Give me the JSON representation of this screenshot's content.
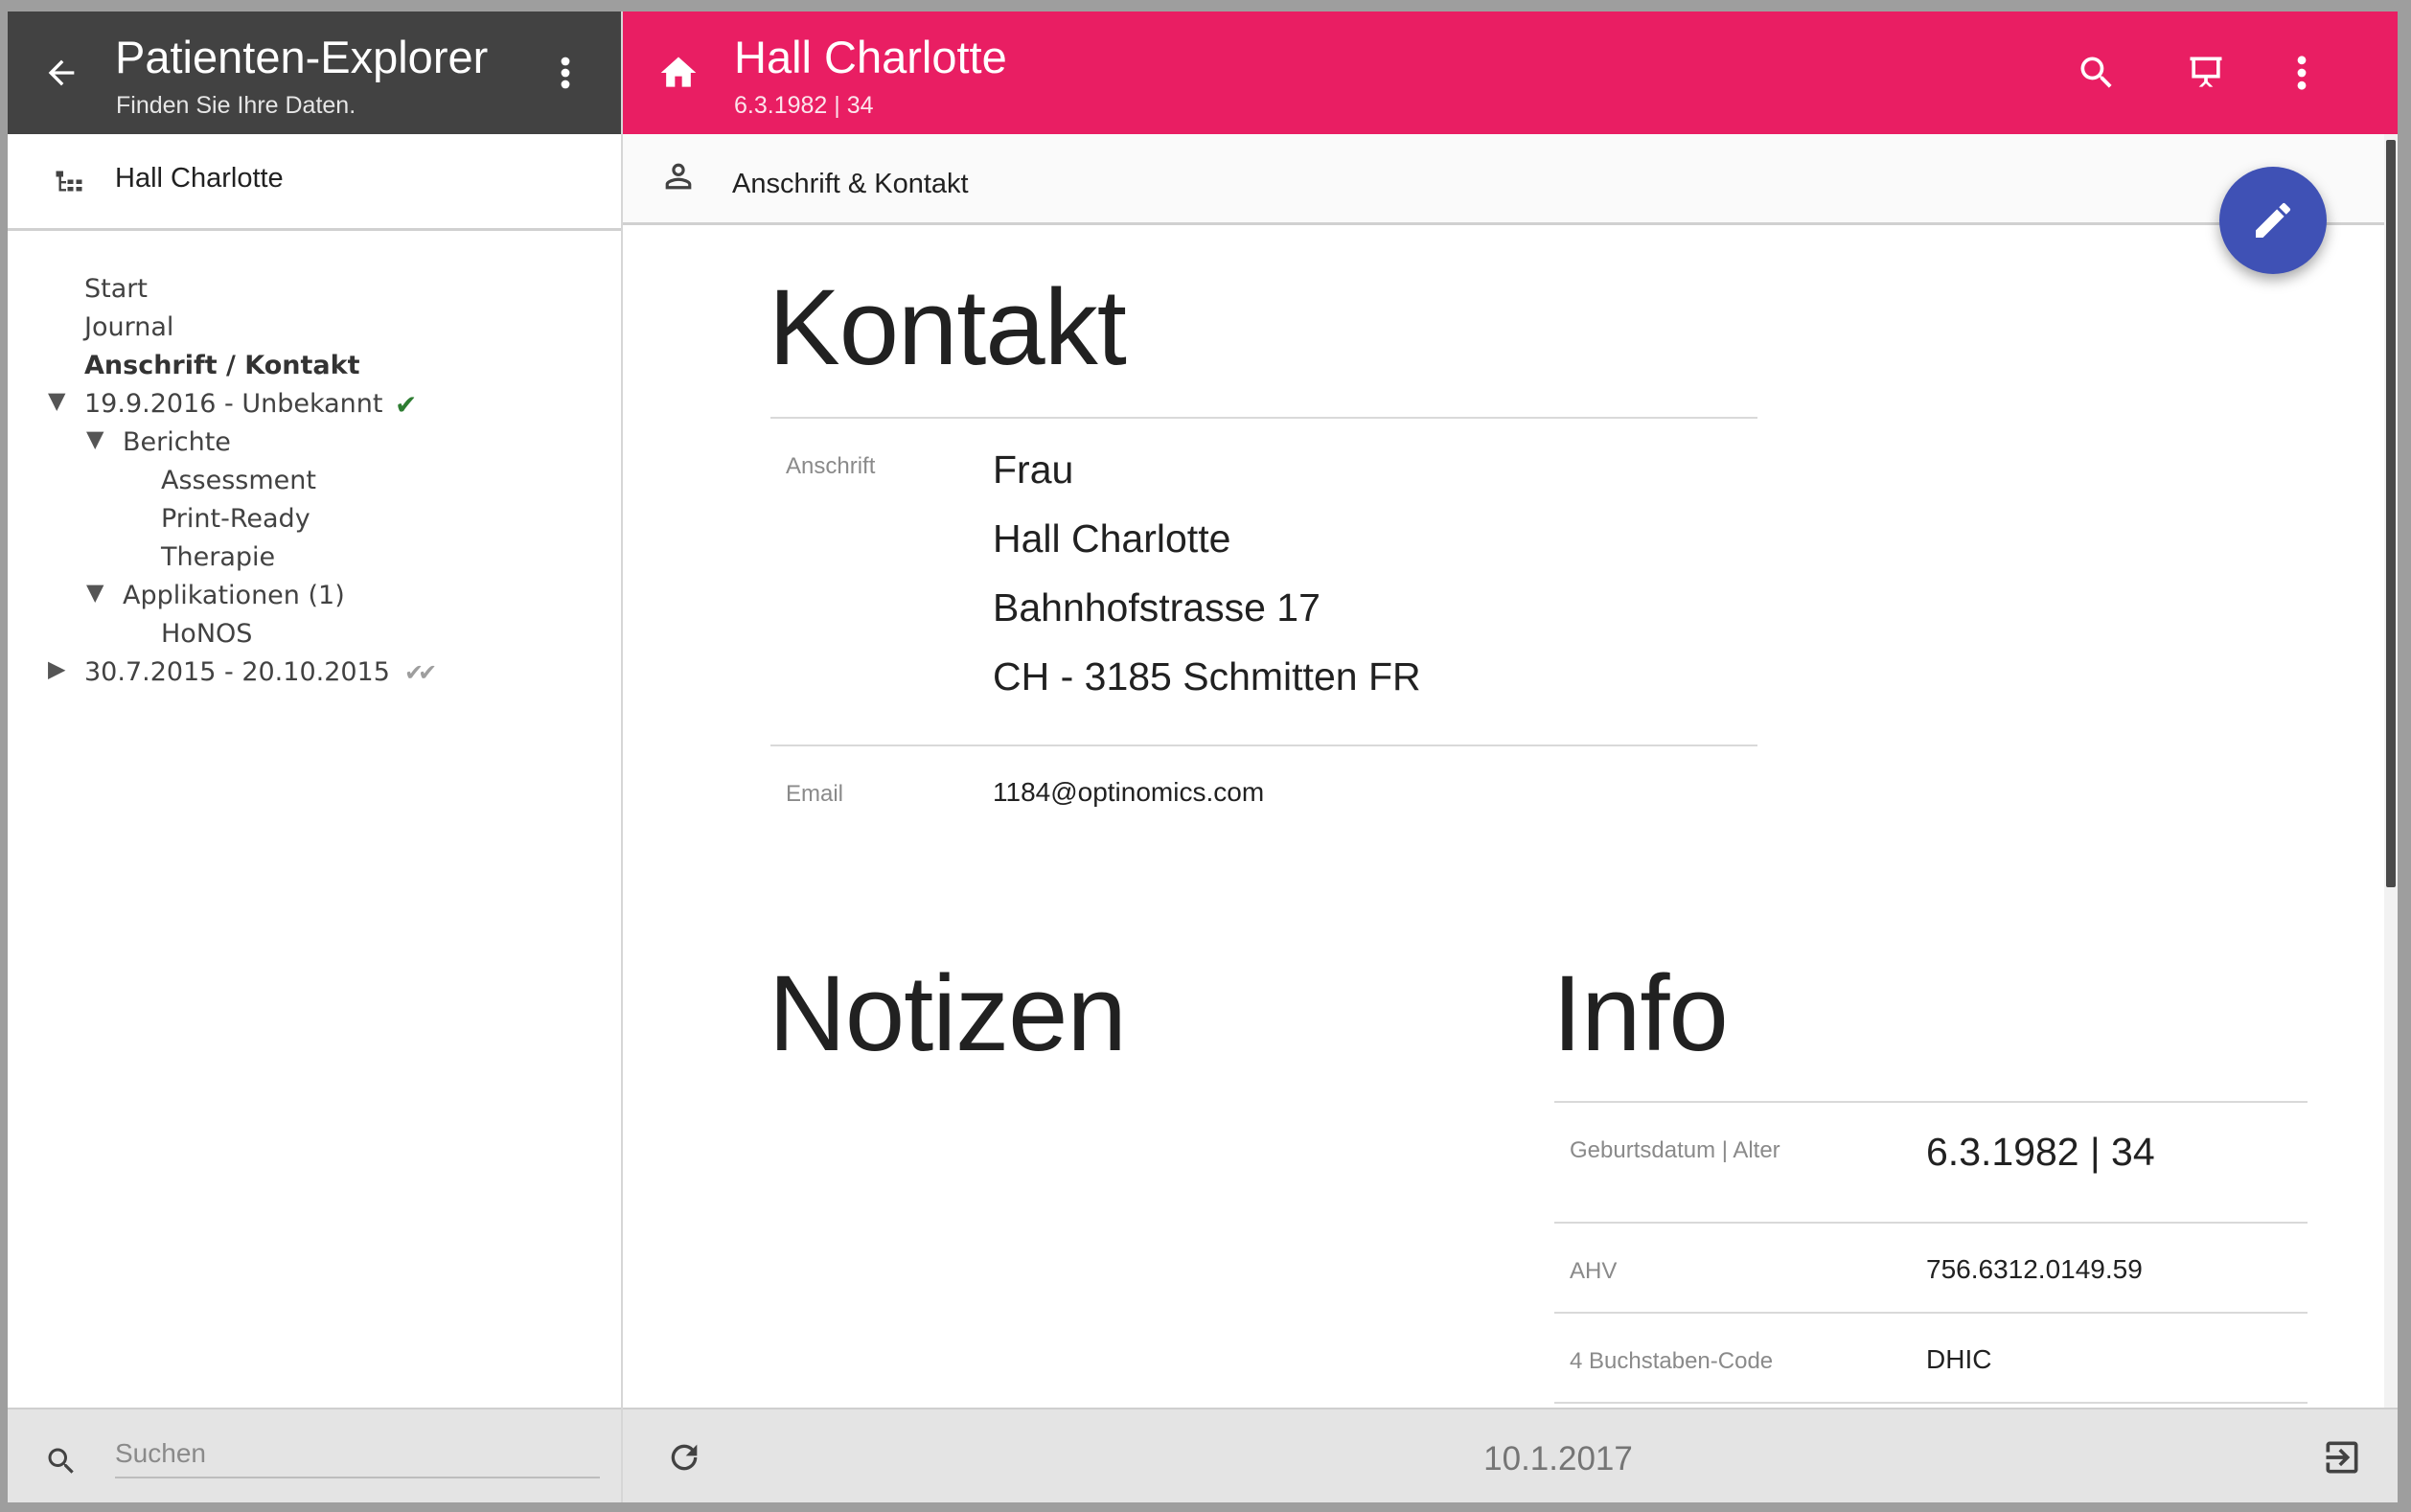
{
  "explorer": {
    "title": "Patienten-Explorer",
    "subtitle": "Finden Sie Ihre Daten.",
    "patient_label": "Hall Charlotte",
    "tree": [
      {
        "label": "Start",
        "level": 0,
        "expander": "",
        "check": ""
      },
      {
        "label": "Journal",
        "level": 0,
        "expander": "",
        "check": ""
      },
      {
        "label": "Anschrift / Kontakt",
        "level": 0,
        "expander": "",
        "check": "",
        "selected": true
      },
      {
        "label": "19.9.2016 - Unbekannt",
        "level": 0,
        "expander": "▼",
        "check": "✔"
      },
      {
        "label": "Berichte",
        "level": 1,
        "expander": "▼",
        "check": ""
      },
      {
        "label": "Assessment",
        "level": 2,
        "expander": "",
        "check": ""
      },
      {
        "label": "Print-Ready",
        "level": 2,
        "expander": "",
        "check": ""
      },
      {
        "label": "Therapie",
        "level": 2,
        "expander": "",
        "check": ""
      },
      {
        "label": "Applikationen (1)",
        "level": 1,
        "expander": "▼",
        "check": ""
      },
      {
        "label": "HoNOS",
        "level": 2,
        "expander": "",
        "check": ""
      },
      {
        "label": "30.7.2015 - 20.10.2015",
        "level": 0,
        "expander": "▶",
        "check": "✔✔"
      }
    ],
    "search": {
      "placeholder": "Suchen",
      "value": ""
    }
  },
  "header": {
    "patient_name": "Hall Charlotte",
    "patient_sub": "6.3.1982 | 34",
    "color": "#e91e63",
    "icons": [
      "home-icon",
      "search-icon",
      "presentation-icon",
      "more-vert-icon"
    ]
  },
  "section": {
    "label": "Anschrift & Kontakt",
    "edit_icon": "pencil-icon",
    "fab_color": "#3f51b5"
  },
  "kontakt": {
    "heading": "Kontakt",
    "anschrift_label": "Anschrift",
    "anschrift_lines": [
      "Frau",
      "Hall Charlotte",
      "Bahnhofstrasse 17",
      "CH - 3185 Schmitten FR"
    ],
    "email_label": "Email",
    "email": "1184@optinomics.com"
  },
  "notizen": {
    "heading": "Notizen"
  },
  "info": {
    "heading": "Info",
    "rows": [
      {
        "label": "Geburtsdatum | Alter",
        "value": "6.3.1982 | 34"
      },
      {
        "label": "AHV",
        "value": "756.6312.0149.59"
      },
      {
        "label": "4 Buchstaben-Code",
        "value": "DHIC"
      }
    ]
  },
  "footer": {
    "date": "10.1.2017"
  }
}
